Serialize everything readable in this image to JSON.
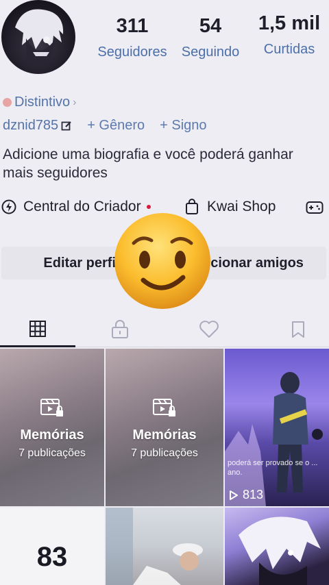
{
  "profile": {
    "stats": [
      {
        "value": "311",
        "label": "Seguidores"
      },
      {
        "value": "54",
        "label": "Seguindo"
      },
      {
        "value": "1,5 mil",
        "label": "Curtidas"
      }
    ],
    "badge_label": "Distintivo",
    "username": "dznid785",
    "add_gender": "+ Gênero",
    "add_sign": "+ Signo",
    "bio": "Adicione uma biografia e você poderá ganhar mais seguidores"
  },
  "creator_row": {
    "central_label": "Central do Criador",
    "shop_label": "Kwai Shop"
  },
  "actions": {
    "edit_label": "Editar perfil",
    "add_friends_label": "Adicionar amigos"
  },
  "tabs": {
    "active": "grid"
  },
  "grid": {
    "memories": [
      {
        "title": "Memórias",
        "count": "7 publicações"
      },
      {
        "title": "Memórias",
        "count": "7 publicações"
      }
    ],
    "video_views": "813",
    "video_caption": "poderá ser provado se o ... ano.",
    "card_number": "83"
  },
  "colors": {
    "accent_blue": "#4b6fa8",
    "notification_red": "#d81b3a"
  }
}
